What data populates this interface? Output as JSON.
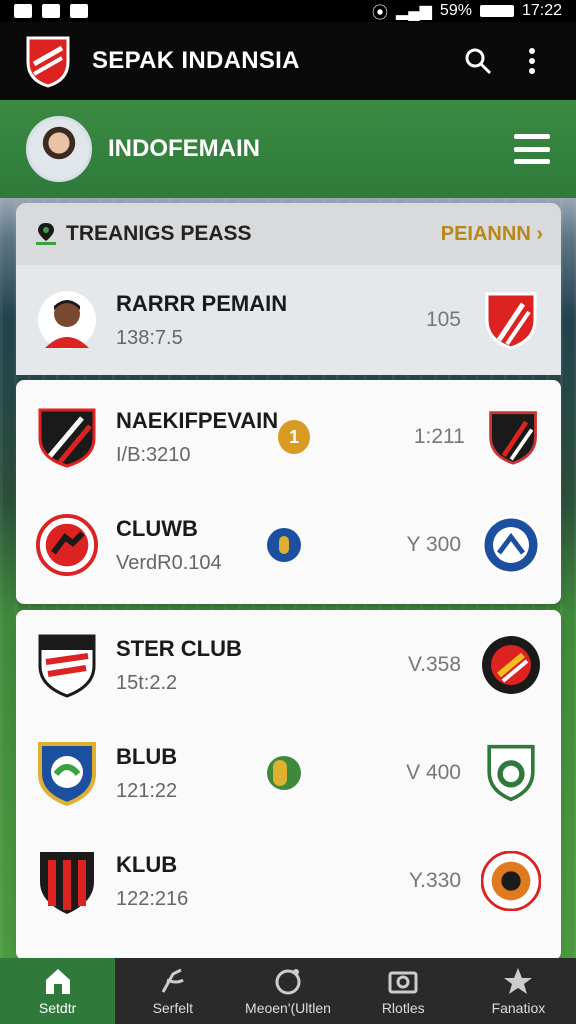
{
  "status_bar": {
    "battery": "59%",
    "time": "17:22"
  },
  "app_bar": {
    "title": "SEPAK INDANSIA",
    "search_icon": "search-icon",
    "more_icon": "more-vertical-icon"
  },
  "profile": {
    "name": "INDOFEMAIN",
    "menu_icon": "hamburger-menu-icon"
  },
  "card": {
    "title": "TREANIGS PEASS",
    "link_label": "PEIANNN",
    "link_icon": "chevron-right-icon"
  },
  "rows": [
    {
      "name": "RARRR PEMAIN",
      "sub": "138:7.5",
      "value": "105",
      "badge": ""
    },
    {
      "name": "NAEKIFPEVAIN",
      "sub": "I/B:3210",
      "value": "1:211",
      "badge": "1"
    },
    {
      "name": "CLUWB",
      "sub": "VerdR0.104",
      "value": "Y 300",
      "badge": " "
    },
    {
      "name": "STER CLUB",
      "sub": "15t:2.2",
      "value": "V.358",
      "badge": ""
    },
    {
      "name": "BLUB",
      "sub": "121:22",
      "value": "V 400",
      "badge": " "
    },
    {
      "name": "KLUB",
      "sub": "122:216",
      "value": "Y.330",
      "badge": ""
    }
  ],
  "bottom_nav": [
    {
      "label": "Setdtr",
      "icon": "home-icon",
      "active": true
    },
    {
      "label": "Serfelt",
      "icon": "whistle-icon",
      "active": false
    },
    {
      "label": "Meoen'(Ultlen",
      "icon": "refresh-ball-icon",
      "active": false
    },
    {
      "label": "Rlotles",
      "icon": "camera-icon",
      "active": false
    },
    {
      "label": "Fanatiox",
      "icon": "star-person-icon",
      "active": false
    }
  ],
  "colors": {
    "header_black": "#0a0a0a",
    "profile_green": "#2f7a3a",
    "link_gold": "#b8871a",
    "nav_dark": "#2a2a2a"
  }
}
